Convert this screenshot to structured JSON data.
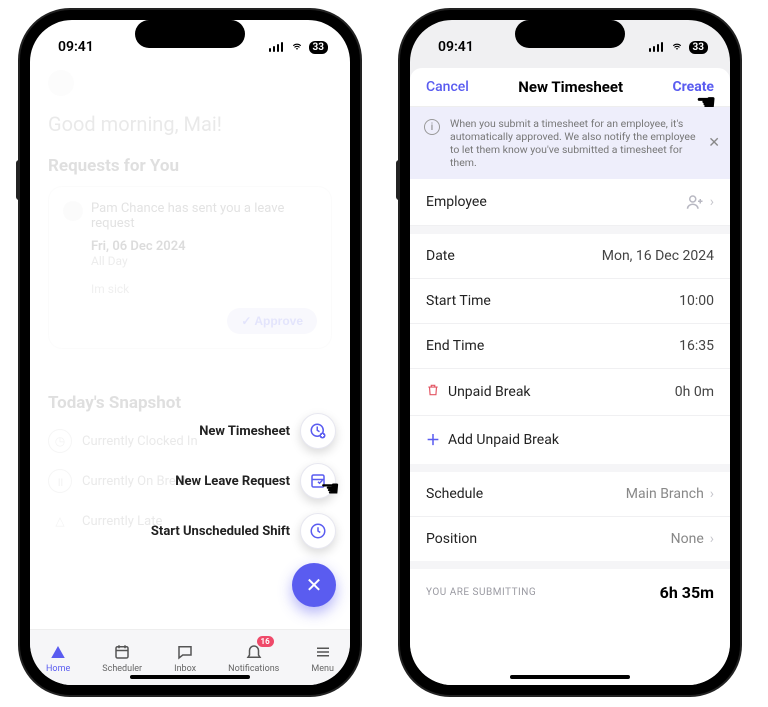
{
  "status": {
    "time": "09:41",
    "battery": "33"
  },
  "left": {
    "greeting_prefix": "Good morning,",
    "greeting_name": "Mai!",
    "requests_title": "Requests for You",
    "request": {
      "text": "Pam Chance has sent you a leave request",
      "date": "Fri, 06 Dec 2024",
      "duration": "All Day",
      "note": "Im sick",
      "approve_label": "✓ Approve"
    },
    "snapshot_title": "Today's Snapshot",
    "snapshot": {
      "clocked": "Currently Clocked In",
      "break": "Currently On Break",
      "late": "Currently Late"
    },
    "fab": {
      "timesheet": "New Timesheet",
      "leave": "New Leave Request",
      "shift": "Start Unscheduled Shift",
      "close": "✕"
    },
    "tabs": {
      "home": "Home",
      "scheduler": "Scheduler",
      "inbox": "Inbox",
      "notifications": "Notifications",
      "notifications_badge": "16",
      "menu": "Menu"
    }
  },
  "right": {
    "cancel": "Cancel",
    "title": "New Timesheet",
    "create": "Create",
    "info": "When you submit a timesheet for an employee, it's automatically approved. We also notify the employee to let them know you've submitted a timesheet for them.",
    "rows": {
      "employee_label": "Employee",
      "date_label": "Date",
      "date_value": "Mon, 16 Dec 2024",
      "start_label": "Start Time",
      "start_value": "10:00",
      "end_label": "End Time",
      "end_value": "16:35",
      "unpaid_label": "Unpaid Break",
      "unpaid_value": "0h 0m",
      "add_unpaid": "Add Unpaid Break",
      "schedule_label": "Schedule",
      "schedule_value": "Main Branch",
      "position_label": "Position",
      "position_value": "None"
    },
    "submit_label": "YOU ARE SUBMITTING",
    "submit_value": "6h 35m"
  }
}
